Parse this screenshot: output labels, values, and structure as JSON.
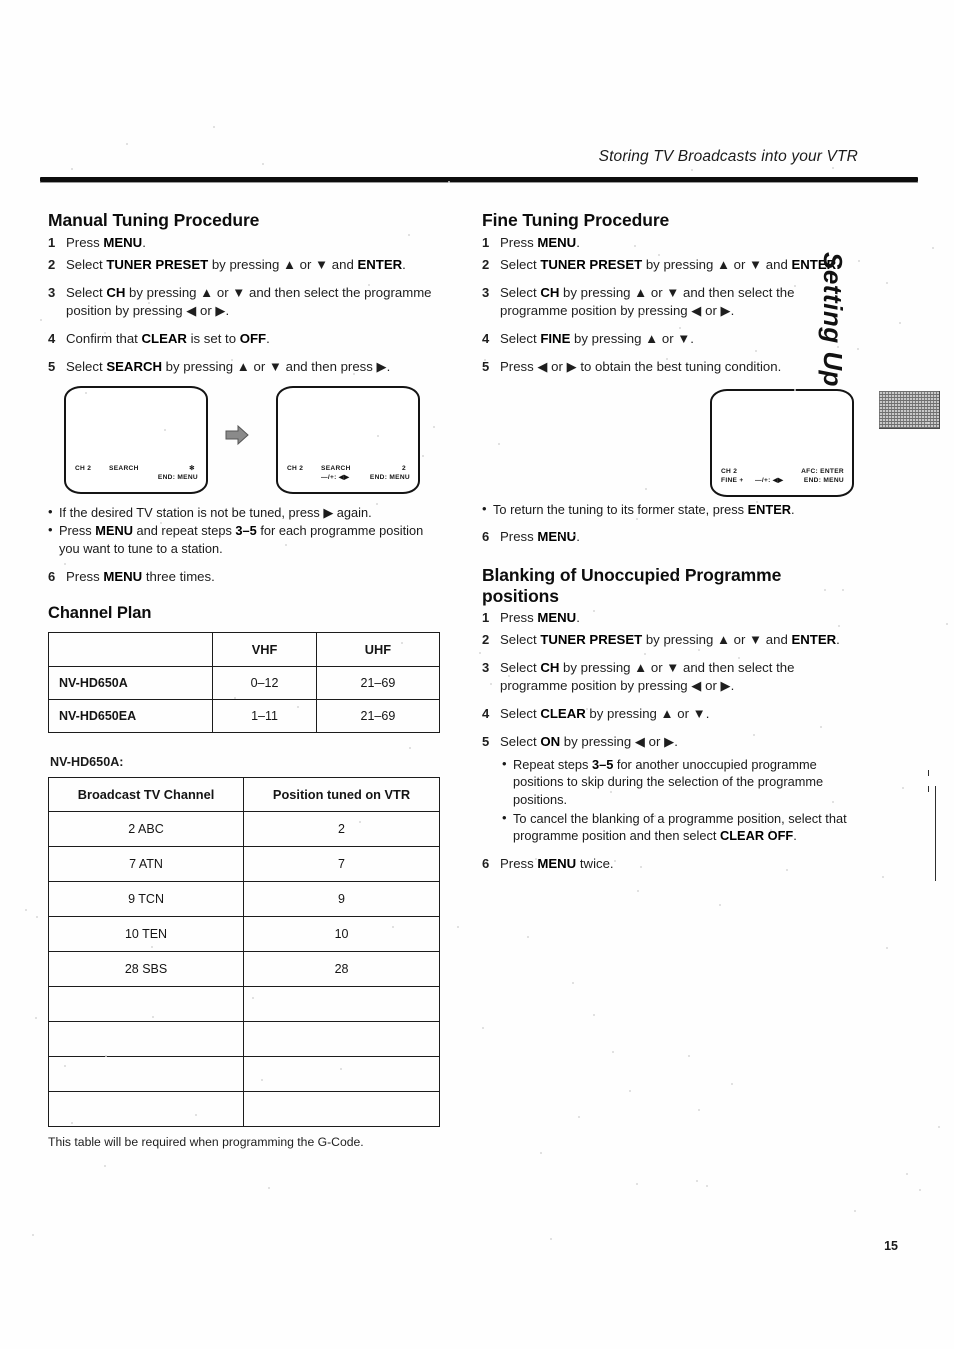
{
  "header": {
    "running_head": "Storing TV Broadcasts into your VTR"
  },
  "side_tab": {
    "label": "Setting Up"
  },
  "page_number": "15",
  "left_column": {
    "manual_tuning": {
      "heading": "Manual Tuning Procedure",
      "steps": [
        {
          "num": "1",
          "html": "Press <b>MENU</b>."
        },
        {
          "num": "2",
          "html": "Select <b>TUNER PRESET</b> by pressing ▲ or ▼ and <b>ENTER</b>."
        },
        {
          "num": "3",
          "html": "Select <b>CH</b> by pressing ▲ or ▼ and then select the programme position by pressing ◀ or ▶."
        },
        {
          "num": "4",
          "html": "Confirm that <b>CLEAR</b> is set to <b>OFF</b>."
        },
        {
          "num": "5",
          "html": "Select <b>SEARCH</b> by pressing ▲ or ▼ and then press ▶."
        }
      ],
      "screen_before": {
        "ch": "CH 2",
        "mode": "SEARCH",
        "value": "✻",
        "end": "END: MENU"
      },
      "screen_after": {
        "ch": "CH 2",
        "mode": "SEARCH",
        "value": "2",
        "adjust": "—/+: ◀▶",
        "end": "END: MENU"
      },
      "bullets": [
        "If the desired TV station is not be tuned, press ▶ again.",
        "Press <b>MENU</b> and repeat steps <b>3–5</b> for each programme position you want to tune to a station."
      ],
      "final_step": {
        "num": "6",
        "html": "Press <b>MENU</b> three times."
      }
    },
    "channel_plan": {
      "heading": "Channel Plan",
      "columns": [
        "",
        "VHF",
        "UHF"
      ],
      "rows": [
        [
          "NV-HD650A",
          "0–12",
          "21–69"
        ],
        [
          "NV-HD650EA",
          "1–11",
          "21–69"
        ]
      ]
    },
    "broadcast_table": {
      "model_label": "NV-HD650A:",
      "columns": [
        "Broadcast TV Channel",
        "Position tuned on VTR"
      ],
      "rows": [
        [
          "2 ABC",
          "2"
        ],
        [
          "7 ATN",
          "7"
        ],
        [
          "9 TCN",
          "9"
        ],
        [
          "10 TEN",
          "10"
        ],
        [
          "28 SBS",
          "28"
        ],
        [
          "",
          ""
        ],
        [
          "",
          ""
        ],
        [
          "",
          ""
        ],
        [
          "",
          ""
        ]
      ],
      "note": "This table will be required when programming the G-Code."
    }
  },
  "right_column": {
    "fine_tuning": {
      "heading": "Fine Tuning Procedure",
      "steps": [
        {
          "num": "1",
          "html": "Press <b>MENU</b>."
        },
        {
          "num": "2",
          "html": "Select <b>TUNER PRESET</b> by pressing ▲ or ▼ and <b>ENTER</b>."
        },
        {
          "num": "3",
          "html": "Select <b>CH</b> by pressing ▲ or ▼ and then select the programme position by pressing ◀ or ▶."
        },
        {
          "num": "4",
          "html": "Select <b>FINE</b> by pressing ▲ or ▼."
        },
        {
          "num": "5",
          "html": "Press ◀ or ▶ to obtain the best tuning condition."
        }
      ],
      "screen": {
        "ch": "CH 2",
        "mode": "FINE  +",
        "adjust": "—/+: ◀▶",
        "end_top": "AFC: ENTER",
        "end_bottom": "END: MENU"
      },
      "bullets": [
        "To return the tuning to its former state, press <b>ENTER</b>."
      ],
      "final_step": {
        "num": "6",
        "html": "Press <b>MENU</b>."
      }
    },
    "blanking": {
      "heading_line1": "Blanking of Unoccupied Programme",
      "heading_line2": "positions",
      "steps": [
        {
          "num": "1",
          "html": "Press <b>MENU</b>."
        },
        {
          "num": "2",
          "html": "Select <b>TUNER PRESET</b> by pressing ▲ or ▼ and <b>ENTER</b>."
        },
        {
          "num": "3",
          "html": "Select <b>CH</b> by pressing ▲ or ▼ and then select the programme position by pressing ◀ or ▶."
        },
        {
          "num": "4",
          "html": "Select <b>CLEAR</b> by pressing ▲ or ▼."
        },
        {
          "num": "5",
          "html": "Select <b>ON</b> by pressing ◀ or ▶."
        }
      ],
      "bullets": [
        "Repeat steps <b>3–5</b> for another unoccupied programme positions to skip during the selection of the programme positions.",
        "To cancel the blanking of a programme position, select that programme position and then select <b>CLEAR OFF</b>."
      ],
      "final_step": {
        "num": "6",
        "html": "Press <b>MENU</b> twice."
      }
    }
  }
}
